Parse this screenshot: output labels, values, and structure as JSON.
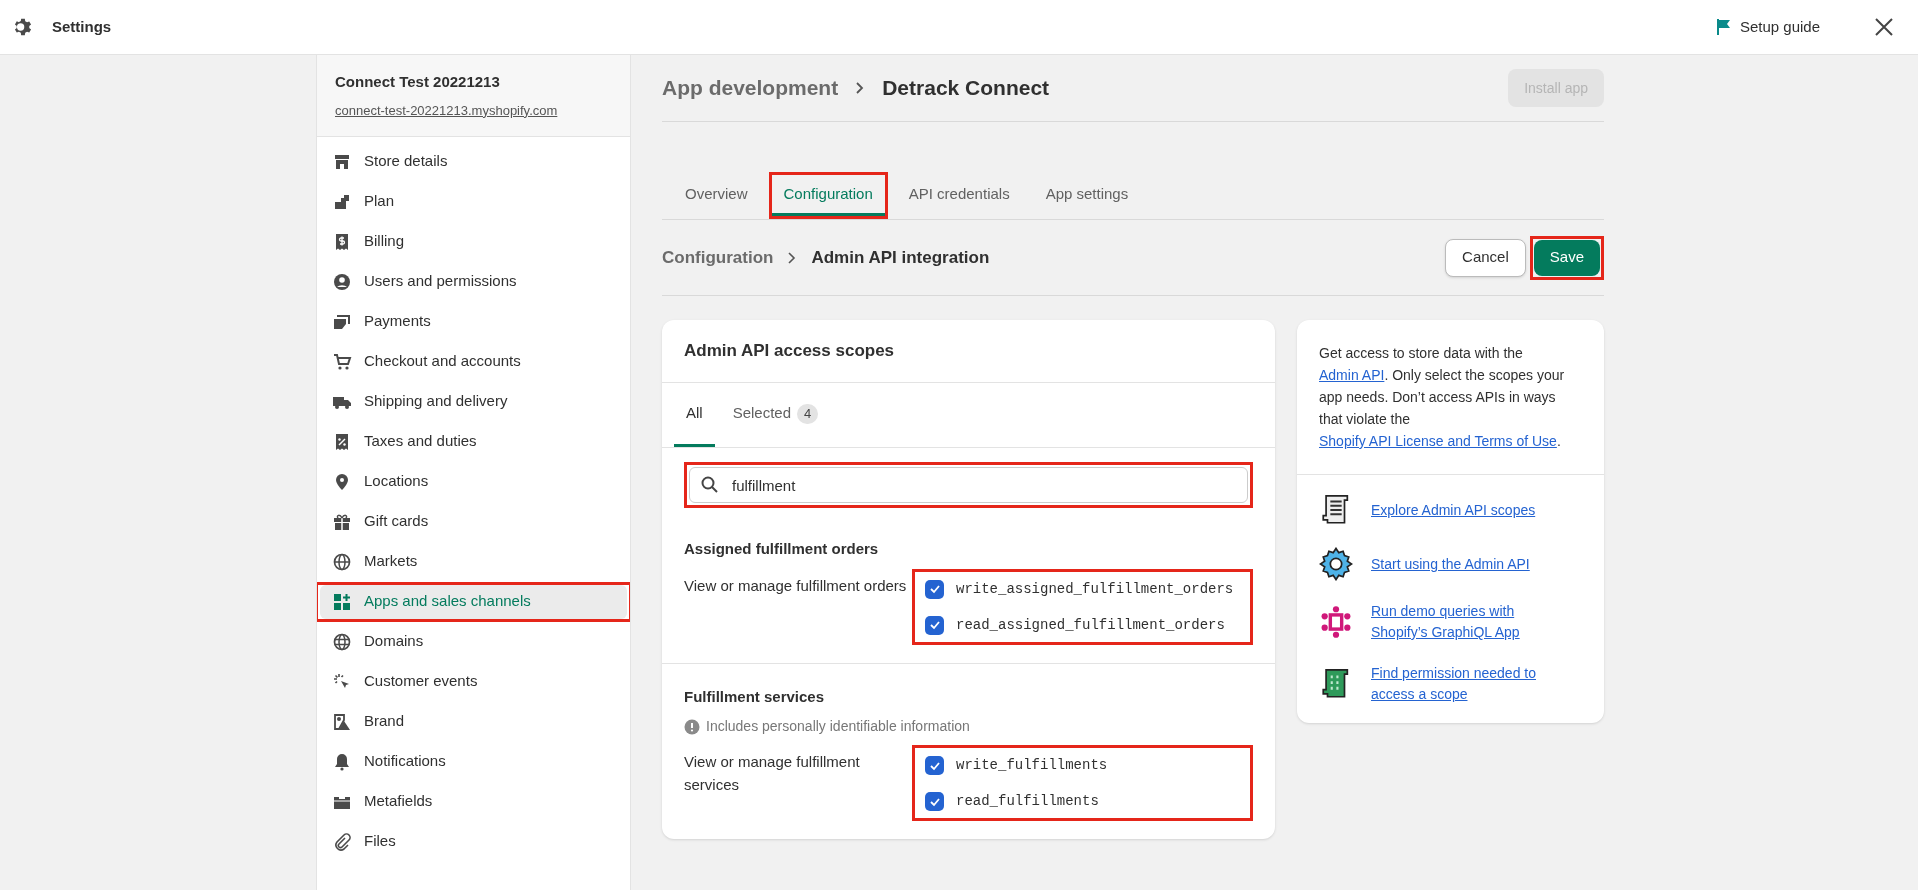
{
  "top_bar": {
    "title": "Settings",
    "setup_guide": "Setup guide"
  },
  "sidebar": {
    "store_name": "Connect Test 20221213",
    "store_url": "connect-test-20221213.myshopify.com",
    "items": [
      {
        "label": "Store details",
        "selected": false,
        "highlighted": false
      },
      {
        "label": "Plan",
        "selected": false,
        "highlighted": false
      },
      {
        "label": "Billing",
        "selected": false,
        "highlighted": false
      },
      {
        "label": "Users and permissions",
        "selected": false,
        "highlighted": false
      },
      {
        "label": "Payments",
        "selected": false,
        "highlighted": false
      },
      {
        "label": "Checkout and accounts",
        "selected": false,
        "highlighted": false
      },
      {
        "label": "Shipping and delivery",
        "selected": false,
        "highlighted": false
      },
      {
        "label": "Taxes and duties",
        "selected": false,
        "highlighted": false
      },
      {
        "label": "Locations",
        "selected": false,
        "highlighted": false
      },
      {
        "label": "Gift cards",
        "selected": false,
        "highlighted": false
      },
      {
        "label": "Markets",
        "selected": false,
        "highlighted": false
      },
      {
        "label": "Apps and sales channels",
        "selected": true,
        "highlighted": true
      },
      {
        "label": "Domains",
        "selected": false,
        "highlighted": false
      },
      {
        "label": "Customer events",
        "selected": false,
        "highlighted": false
      },
      {
        "label": "Brand",
        "selected": false,
        "highlighted": false
      },
      {
        "label": "Notifications",
        "selected": false,
        "highlighted": false
      },
      {
        "label": "Metafields",
        "selected": false,
        "highlighted": false
      },
      {
        "label": "Files",
        "selected": false,
        "highlighted": false
      }
    ]
  },
  "page": {
    "breadcrumb": "App development",
    "title": "Detrack Connect",
    "install_button": {
      "label": "Install app",
      "disabled": true
    },
    "tabs": [
      {
        "label": "Overview",
        "selected": false,
        "highlighted": false
      },
      {
        "label": "Configuration",
        "selected": true,
        "highlighted": true
      },
      {
        "label": "API credentials",
        "selected": false,
        "highlighted": false
      },
      {
        "label": "App settings",
        "selected": false,
        "highlighted": false
      }
    ],
    "sub_breadcrumb": "Configuration",
    "sub_title": "Admin API integration",
    "cancel_button": {
      "label": "Cancel"
    },
    "save_button": {
      "label": "Save",
      "highlighted": true
    }
  },
  "scopes_card": {
    "title": "Admin API access scopes",
    "tabs": [
      {
        "label": "All",
        "selected": true
      },
      {
        "label": "Selected",
        "selected": false,
        "count": "4"
      }
    ],
    "search": {
      "value": "fulfillment",
      "highlighted": true
    },
    "groups": [
      {
        "title": "Assigned fulfillment orders",
        "description": "View or manage fulfillment orders",
        "highlighted": true,
        "scopes": [
          {
            "name": "write_assigned_fulfillment_orders",
            "checked": true
          },
          {
            "name": "read_assigned_fulfillment_orders",
            "checked": true
          }
        ]
      },
      {
        "title": "Fulfillment services",
        "note": "Includes personally identifiable information",
        "description": "View or manage fulfillment services",
        "highlighted": true,
        "scopes": [
          {
            "name": "write_fulfillments",
            "checked": true
          },
          {
            "name": "read_fulfillments",
            "checked": true
          }
        ]
      }
    ]
  },
  "help_panel": {
    "intro": [
      {
        "kind": "text",
        "text": "Get access to store data with the "
      },
      {
        "kind": "link",
        "text": "Admin API"
      },
      {
        "kind": "text",
        "text": ". Only select the scopes your app needs. Don’t access APIs in ways that violate the "
      },
      {
        "kind": "link",
        "text": "Shopify API License and Terms of Use"
      },
      {
        "kind": "text",
        "text": "."
      }
    ],
    "links": [
      "Explore Admin API scopes",
      "Start using the Admin API",
      "Run demo queries with Shopify’s GraphiQL App",
      "Find permission needed to access a scope"
    ]
  }
}
